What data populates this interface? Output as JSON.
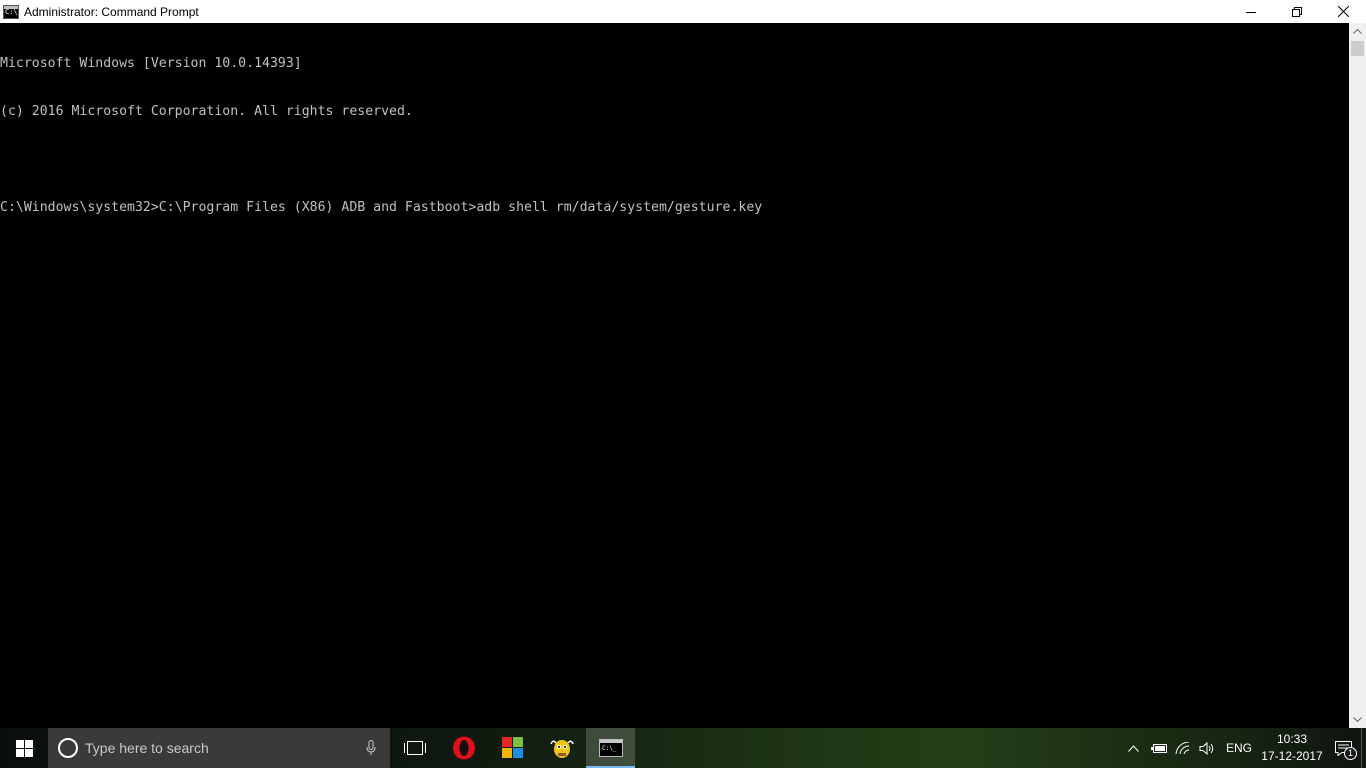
{
  "window": {
    "title": "Administrator: Command Prompt",
    "controls": [
      "minimize",
      "restore",
      "close"
    ]
  },
  "console": {
    "lines": [
      "Microsoft Windows [Version 10.0.14393]",
      "(c) 2016 Microsoft Corporation. All rights reserved.",
      "",
      "C:\\Windows\\system32>C:\\Program Files (X86) ADB and Fastboot>adb shell rm/data/system/gesture.key"
    ]
  },
  "taskbar": {
    "search_placeholder": "Type here to search",
    "apps": [
      {
        "name": "task-view",
        "icon": "task-view-icon"
      },
      {
        "name": "opera",
        "icon": "opera-icon"
      },
      {
        "name": "store",
        "icon": "tiles-icon"
      },
      {
        "name": "mascot-app",
        "icon": "cartoon-icon"
      },
      {
        "name": "command-prompt",
        "icon": "cmd-icon",
        "active": true
      }
    ],
    "tray": {
      "language": "ENG",
      "time": "10:33",
      "date": "17-12-2017",
      "notification_count": "1"
    }
  }
}
